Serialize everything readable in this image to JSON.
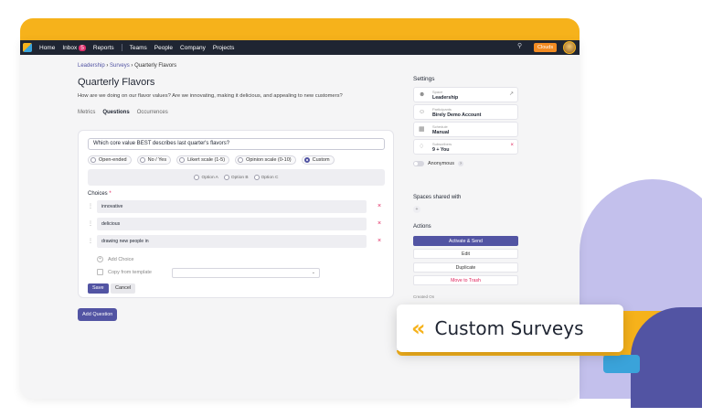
{
  "nav": {
    "home": "Home",
    "inbox": "Inbox",
    "inbox_badge": "5",
    "reports": "Reports",
    "teams": "Teams",
    "people": "People",
    "company": "Company",
    "projects": "Projects",
    "clouds_button": "Clouds"
  },
  "breadcrumb": {
    "item1": "Leadership",
    "item2": "Surveys",
    "current": "Quarterly Flavors",
    "sep": "›"
  },
  "page": {
    "title": "Quarterly Flavors",
    "description": "How are we doing on our flavor values? Are we innovating, making it delicious, and appealing to new customers?"
  },
  "tabs": [
    "Metrics",
    "Questions",
    "Occurrences"
  ],
  "editor": {
    "question_value": "Which core value BEST describes last quarter's flavors?",
    "types": [
      {
        "label": "Open-ended",
        "selected": false
      },
      {
        "label": "No / Yes",
        "selected": false
      },
      {
        "label": "Likert scale (1-5)",
        "selected": false
      },
      {
        "label": "Opinion scale (0-10)",
        "selected": false
      },
      {
        "label": "Custom",
        "selected": true
      }
    ],
    "preview_options": [
      "Option A",
      "Option B",
      "Option C"
    ],
    "choices_label": "Choices",
    "required_mark": "*",
    "choices": [
      "innovative",
      "delicious",
      "drawing new people in"
    ],
    "add_choice": "Add Choice",
    "copy_from_template": "Copy from template",
    "save": "Save",
    "cancel": "Cancel"
  },
  "add_question": "Add Question",
  "settings": {
    "title": "Settings",
    "space_label": "Space",
    "space_value": "Leadership",
    "participants_label": "Participants",
    "participants_value": "Birely Demo Account",
    "schedule_label": "Schedule",
    "schedule_value": "Manual",
    "subscribers_label": "Subscribers",
    "subscribers_value": "9 + You",
    "anonymous": "Anonymous",
    "help": "?"
  },
  "shared": {
    "title": "Spaces shared with",
    "add": "+"
  },
  "actions": {
    "title": "Actions",
    "activate": "Activate & Send",
    "edit": "Edit",
    "duplicate": "Duplicate",
    "trash": "Move to Trash"
  },
  "created_on": "Created On",
  "callout": {
    "chevrons": "«",
    "text": "Custom Surveys"
  },
  "icons": {
    "search": "search-icon",
    "drag": "drag-handle-icon",
    "remove": "close-icon",
    "plus": "plus-icon",
    "copy": "copy-icon"
  },
  "colors": {
    "accent": "#5254a3",
    "brand_yellow": "#f6b21b",
    "danger": "#e0245e",
    "topbar": "#1f2532"
  }
}
